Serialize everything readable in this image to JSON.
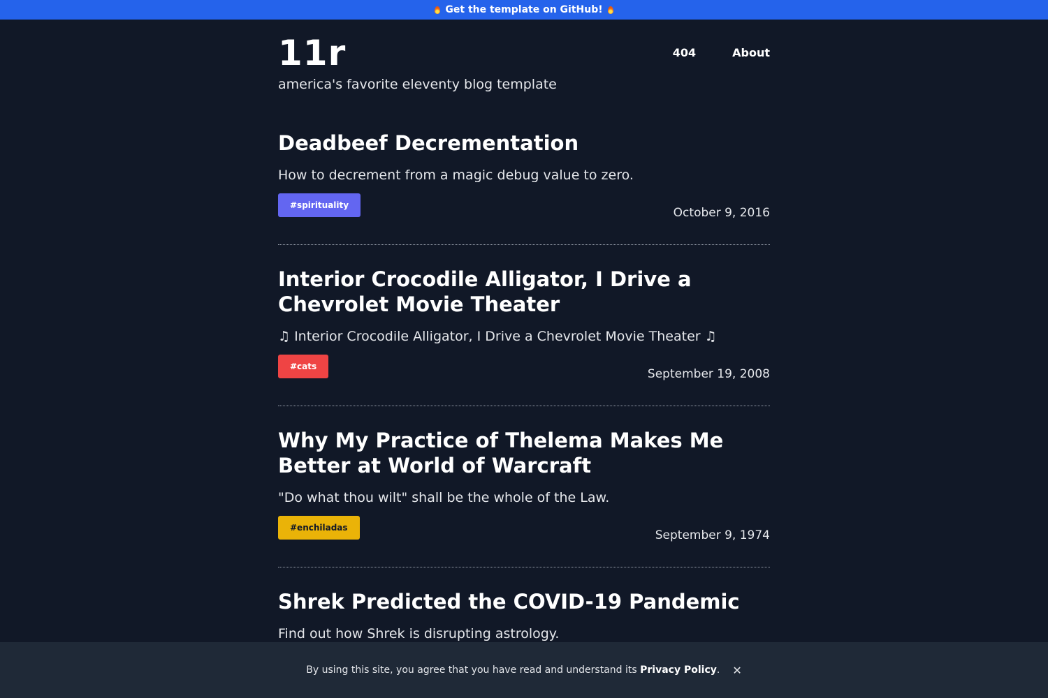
{
  "banner": {
    "text": "Get the template on GitHub!",
    "left_icon": "flame-icon",
    "right_icon": "flame-icon",
    "color": "#2563eb"
  },
  "site": {
    "title": "11r",
    "tagline": "america's favorite eleventy blog template"
  },
  "nav": {
    "items": [
      {
        "label": "404"
      },
      {
        "label": "About"
      }
    ]
  },
  "posts": [
    {
      "title": "Deadbeef Decrementation",
      "description": "How to decrement from a magic debug value to zero.",
      "tag": "#spirituality",
      "tag_color": "#6366f1",
      "date": "October 9, 2016"
    },
    {
      "title": "Interior Crocodile Alligator, I Drive a Chevrolet Movie Theater",
      "description": "♫ Interior Crocodile Alligator, I Drive a Chevrolet Movie Theater ♫",
      "tag": "#cats",
      "tag_color": "#ef4444",
      "date": "September 19, 2008"
    },
    {
      "title": "Why My Practice of Thelema Makes Me Better at World of Warcraft",
      "description": "\"Do what thou wilt\" shall be the whole of the Law.",
      "tag": "#enchiladas",
      "tag_color": "#eab308",
      "date": "September 9, 1974"
    },
    {
      "title": "Shrek Predicted the COVID-19 Pandemic",
      "description": "Find out how Shrek is disrupting astrology."
    }
  ],
  "cookie": {
    "text": "By using this site, you agree that you have read and understand its",
    "link": "Privacy Policy",
    "suffix": ".",
    "close_symbol": "✕"
  },
  "colors": {
    "background": "#111827",
    "cookie_bar": "#1f2937",
    "text": "#ffffff"
  }
}
